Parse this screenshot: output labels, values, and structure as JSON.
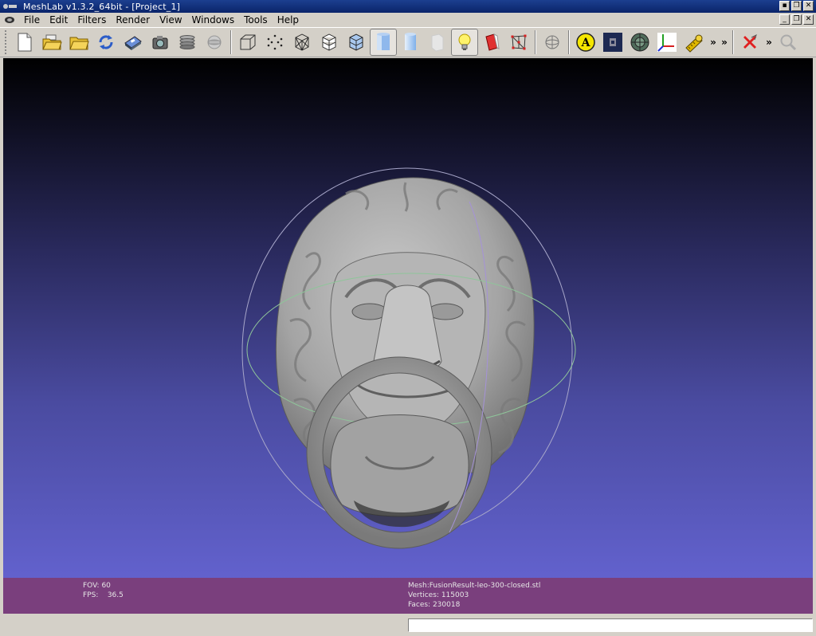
{
  "window": {
    "title": "MeshLab v1.3.2_64bit - [Project_1]",
    "controls": [
      "minimize",
      "restore",
      "close"
    ]
  },
  "menubar": {
    "items": [
      {
        "label": "File"
      },
      {
        "label": "Edit"
      },
      {
        "label": "Filters"
      },
      {
        "label": "Render"
      },
      {
        "label": "View"
      },
      {
        "label": "Windows"
      },
      {
        "label": "Tools"
      },
      {
        "label": "Help"
      }
    ]
  },
  "toolbar": {
    "overflow_label": "»",
    "buttons": [
      {
        "icon": "new-document-icon"
      },
      {
        "icon": "open-project-icon"
      },
      {
        "icon": "import-mesh-icon"
      },
      {
        "icon": "reload-icon"
      },
      {
        "icon": "save-icon"
      },
      {
        "icon": "snapshot-camera-icon"
      },
      {
        "icon": "layers-icon"
      },
      {
        "icon": "raster-icon"
      },
      {
        "icon": "bounding-box-icon"
      },
      {
        "icon": "points-icon"
      },
      {
        "icon": "wireframe-icon"
      },
      {
        "icon": "hidden-lines-icon"
      },
      {
        "icon": "flat-lines-icon"
      },
      {
        "icon": "flat-shading-icon",
        "active": true
      },
      {
        "icon": "smooth-shading-icon"
      },
      {
        "icon": "texture-icon"
      },
      {
        "icon": "light-bulb-icon",
        "active": true
      },
      {
        "icon": "double-side-lighting-icon"
      },
      {
        "icon": "select-vertices-icon"
      },
      {
        "icon": "trackball-icon"
      },
      {
        "icon": "annotation-icon"
      },
      {
        "icon": "shader-icon"
      },
      {
        "icon": "texture-parametrization-icon"
      },
      {
        "icon": "axes-icon"
      },
      {
        "icon": "measure-tool-icon"
      },
      {
        "icon": "delete-selection-icon"
      },
      {
        "icon": "zoom-icon"
      }
    ]
  },
  "viewport": {
    "background_top": "#000000",
    "background_bottom": "#6766d6",
    "mesh_name": "FusionResult-leo-300-closed.stl"
  },
  "info": {
    "fov_label": "FOV:",
    "fov_value": "60",
    "fps_label": "FPS:",
    "fps_value": "36.5",
    "mesh_label": "Mesh:",
    "mesh_value": "FusionResult-leo-300-closed.stl",
    "vertices_label": "Vertices:",
    "vertices_value": "115003",
    "faces_label": "Faces:",
    "faces_value": "230018",
    "panel_color": "#7a3f7d"
  },
  "statusbar": {
    "message": ""
  }
}
